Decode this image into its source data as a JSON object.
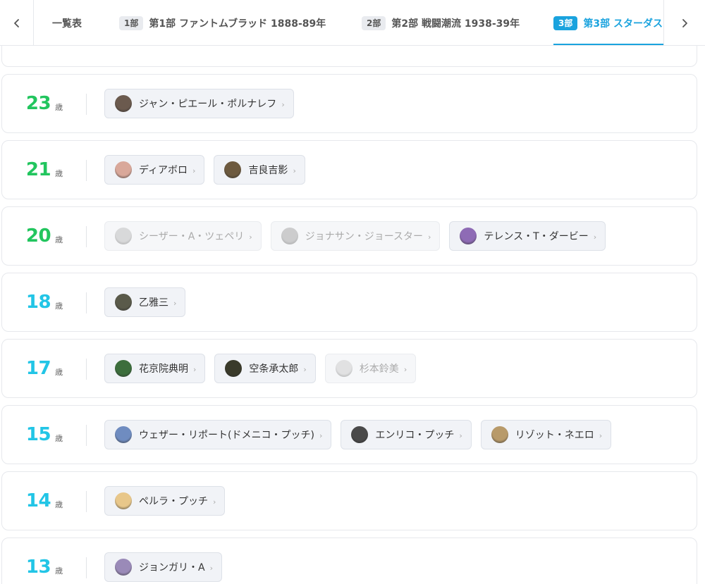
{
  "tabs": [
    {
      "label": "一覧表"
    },
    {
      "badge": "1部",
      "label": "第1部 ファントムブラッド 1888-89年"
    },
    {
      "badge": "2部",
      "label": "第2部 戦闘潮流 1938-39年"
    },
    {
      "badge": "3部",
      "label": "第3部 スターダス",
      "active": true
    }
  ],
  "age_unit": "歳",
  "colors": {
    "green": "#22c55e",
    "cyan": "#22c5e6",
    "accent": "#1aa3de"
  },
  "rows": [
    {
      "age": "23",
      "color": "#22c55e",
      "chips": [
        {
          "name": "ジャン・ピエール・ポルナレフ",
          "avatar": "#6b5a4e"
        }
      ]
    },
    {
      "age": "21",
      "color": "#22c55e",
      "chips": [
        {
          "name": "ディアボロ",
          "avatar": "#d9a89a"
        },
        {
          "name": "吉良吉影",
          "avatar": "#6d5a3f"
        }
      ]
    },
    {
      "age": "20",
      "color": "#22c55e",
      "chips": [
        {
          "name": "シーザー・A・ツェペリ",
          "avatar": "#b5b5b5",
          "dim": true
        },
        {
          "name": "ジョナサン・ジョースター",
          "avatar": "#9a9a9a",
          "dim": true
        },
        {
          "name": "テレンス・T・ダービー",
          "avatar": "#8e6bb5"
        }
      ]
    },
    {
      "age": "18",
      "color": "#22c5e6",
      "chips": [
        {
          "name": "乙雅三",
          "avatar": "#5a5a4a"
        }
      ]
    },
    {
      "age": "17",
      "color": "#22c5e6",
      "chips": [
        {
          "name": "花京院典明",
          "avatar": "#3c6e3c"
        },
        {
          "name": "空条承太郎",
          "avatar": "#3a3a2a"
        },
        {
          "name": "杉本鈴美",
          "avatar": "#c8c8c8",
          "dim": true
        }
      ]
    },
    {
      "age": "15",
      "color": "#22c5e6",
      "chips": [
        {
          "name": "ウェザー・リポート(ドメニコ・プッチ)",
          "avatar": "#6f8cc0"
        },
        {
          "name": "エンリコ・プッチ",
          "avatar": "#4a4a4a"
        },
        {
          "name": "リゾット・ネエロ",
          "avatar": "#b89a6a"
        }
      ]
    },
    {
      "age": "14",
      "color": "#22c5e6",
      "chips": [
        {
          "name": "ペルラ・プッチ",
          "avatar": "#e8c78a"
        }
      ]
    },
    {
      "age": "13",
      "color": "#22c5e6",
      "chips": [
        {
          "name": "ジョンガリ・A",
          "avatar": "#9a8ab8"
        }
      ]
    }
  ]
}
